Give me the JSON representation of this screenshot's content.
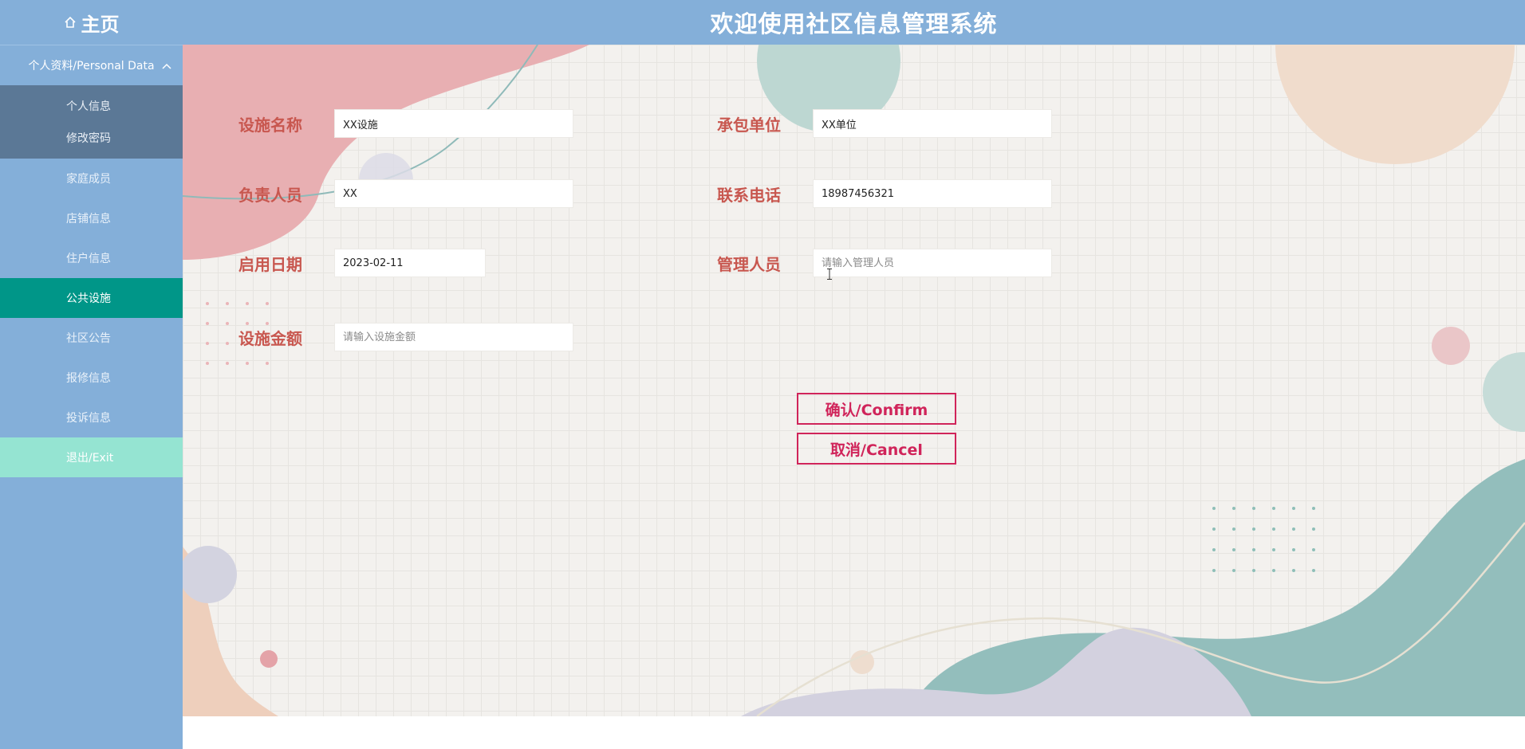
{
  "header": {
    "home_label": "主页",
    "title": "欢迎使用社区信息管理系统"
  },
  "sidebar": {
    "group": {
      "label": "个人资料/Personal Data",
      "expanded": true,
      "items": [
        {
          "label": "个人信息"
        },
        {
          "label": "修改密码"
        }
      ]
    },
    "items": [
      {
        "label": "家庭成员"
      },
      {
        "label": "店铺信息"
      },
      {
        "label": "住户信息"
      },
      {
        "label": "公共设施",
        "active": true
      },
      {
        "label": "社区公告"
      },
      {
        "label": "报修信息"
      },
      {
        "label": "投诉信息"
      },
      {
        "label": "退出/Exit"
      }
    ]
  },
  "form": {
    "facility_name": {
      "label": "设施名称",
      "value": "XX设施",
      "placeholder": ""
    },
    "contractor": {
      "label": "承包单位",
      "value": "XX单位",
      "placeholder": ""
    },
    "person_in_charge": {
      "label": "负责人员",
      "value": "XX",
      "placeholder": ""
    },
    "phone": {
      "label": "联系电话",
      "value": "18987456321",
      "placeholder": ""
    },
    "start_date": {
      "label": "启用日期",
      "value": "2023-02-11",
      "placeholder": ""
    },
    "manager": {
      "label": "管理人员",
      "value": "",
      "placeholder": "请输入管理人员"
    },
    "amount": {
      "label": "设施金额",
      "value": "",
      "placeholder": "请输入设施金额"
    }
  },
  "buttons": {
    "confirm": "确认/Confirm",
    "cancel": "取消/Cancel"
  },
  "colors": {
    "header_bg": "#84afd9",
    "active_menu": "#009688",
    "exit_menu": "#95e4d2",
    "label": "#c8574f",
    "button": "#d0245a"
  },
  "icons": {
    "home": "home-icon",
    "group_toggle": "chevron-up-icon",
    "cursor": "text-cursor-icon"
  }
}
